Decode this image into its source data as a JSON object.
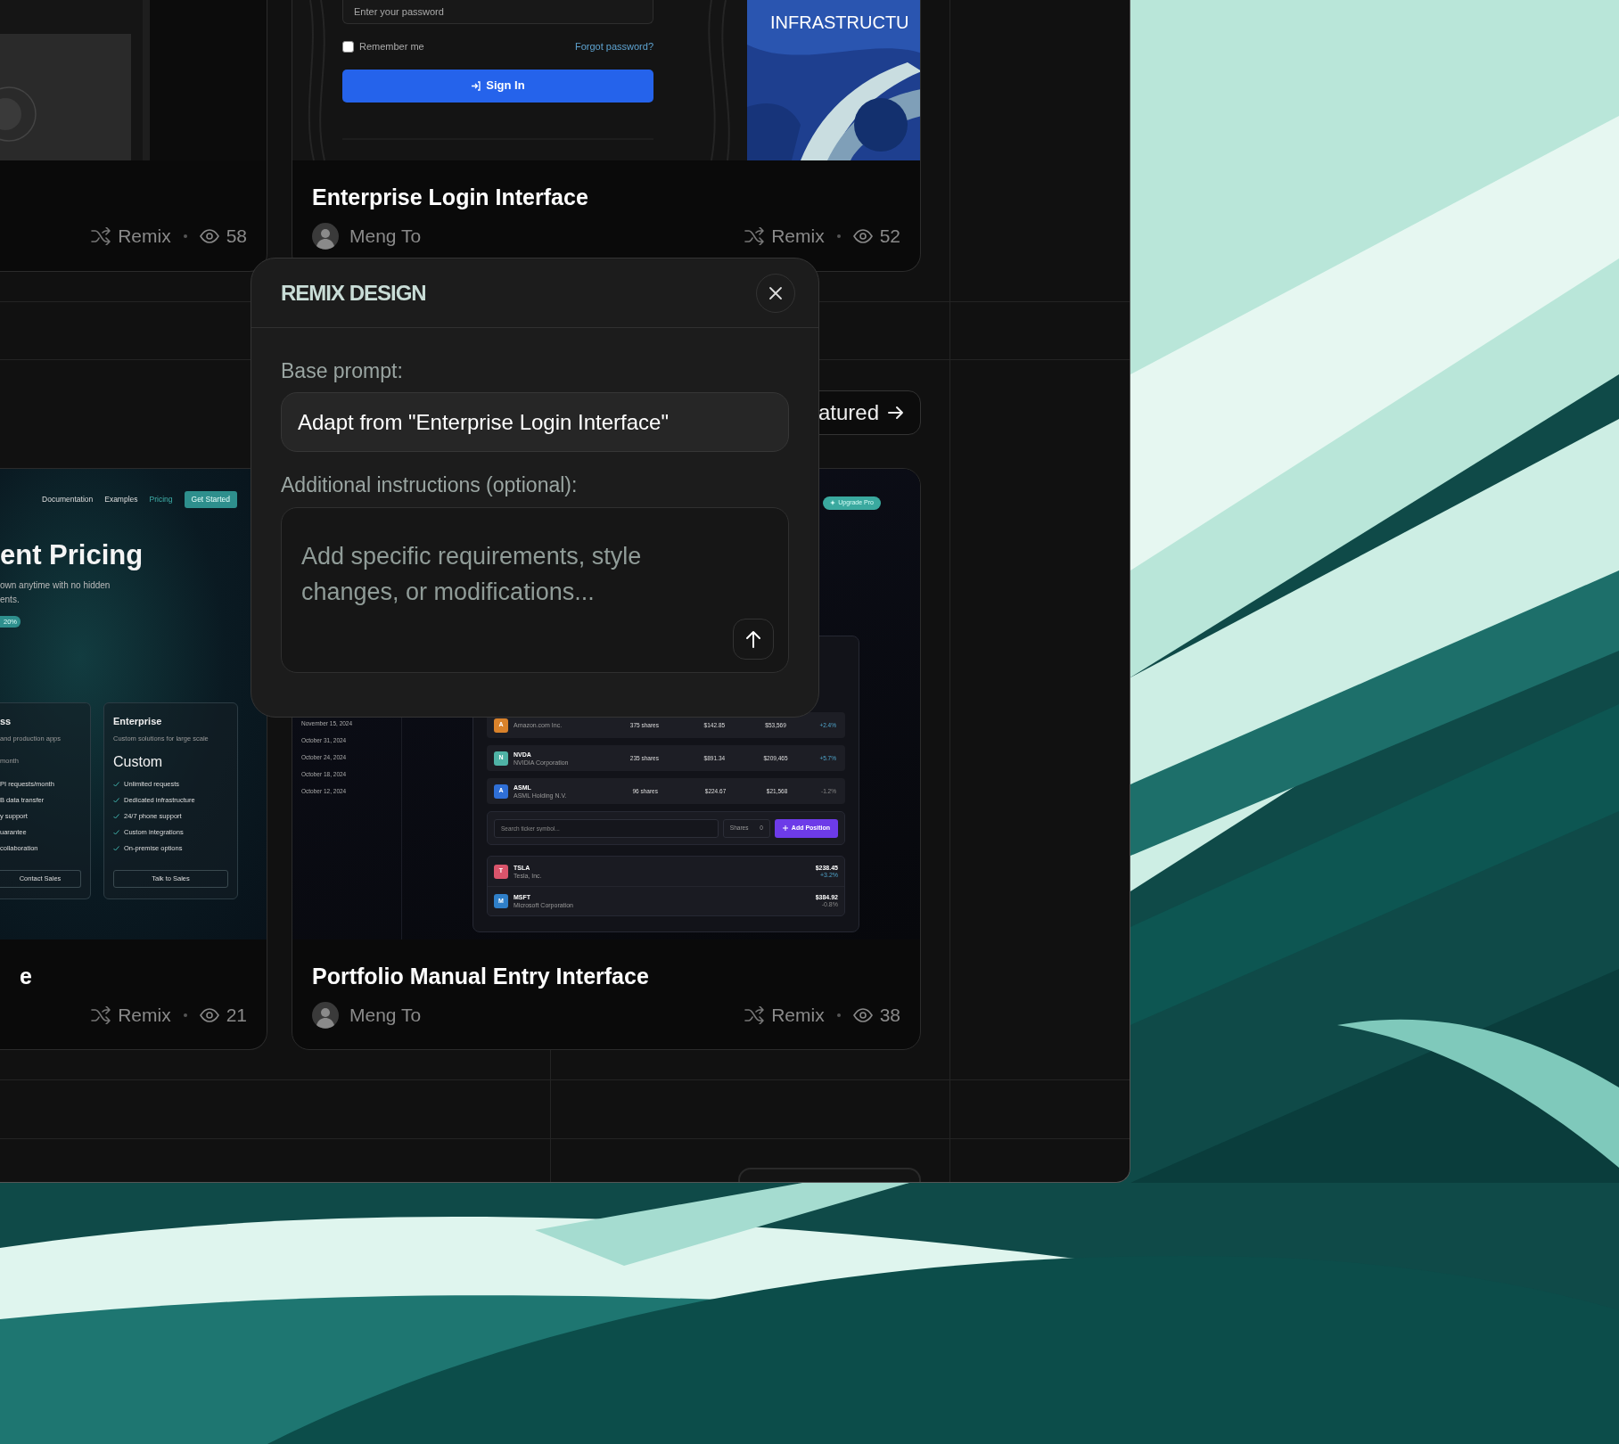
{
  "top_cards": [
    {
      "thumbnail": {
        "kind": "dark-ui"
      },
      "remix_label": "Remix",
      "views": "58"
    },
    {
      "thumbnail": {
        "kind": "login",
        "password_placeholder": "Enter your password",
        "remember_label": "Remember me",
        "remember_checked": false,
        "forgot_link": "Forgot password?",
        "sign_in_label": "Sign In",
        "hero_text": "INFRASTRUCTU"
      },
      "title": "Enterprise Login Interface",
      "author": "Meng To",
      "remix_label": "Remix",
      "views": "52"
    }
  ],
  "featured_button": {
    "label": "atured"
  },
  "bottom_cards": [
    {
      "thumbnail": {
        "kind": "pricing",
        "nav": [
          {
            "label": "Documentation",
            "selected": false
          },
          {
            "label": "Examples",
            "selected": false
          },
          {
            "label": "Pricing",
            "selected": true
          }
        ],
        "cta": "Get Started",
        "heading": "ent Pricing",
        "subtext": [
          "own anytime with no hidden",
          "ents."
        ],
        "badge": "20%",
        "plans": [
          {
            "name": "ss",
            "description": "and production apps",
            "price_note": "month",
            "show_checks": false,
            "features": [
              "PI requests/month",
              "B data transfer",
              "y support",
              "uarantee",
              "collaboration"
            ],
            "button": "Contact Sales"
          },
          {
            "name": "Enterprise",
            "description": "Custom solutions for large scale",
            "price": "Custom",
            "show_checks": true,
            "features": [
              "Unlimited requests",
              "Dedicated infrastructure",
              "24/7 phone support",
              "Custom integrations",
              "On-premise options"
            ],
            "button": "Talk to Sales"
          }
        ]
      },
      "title": "e",
      "remix_label": "Remix",
      "views": "21"
    },
    {
      "thumbnail": {
        "kind": "portfolio",
        "upgrade_badge": "Upgrade Pro",
        "dates": [
          "November 15, 2024",
          "October 31, 2024",
          "October 24, 2024",
          "October 18, 2024",
          "October 12, 2024"
        ],
        "holdings": [
          {
            "letter": "A",
            "color": "#d9822b",
            "name": "Amazon.com Inc.",
            "shares": "375 shares",
            "price": "$142.85",
            "value": "$53,569",
            "change": "+2.4%",
            "rising": true
          },
          {
            "symbol": "NVDA",
            "letter": "N",
            "color": "#4fb3a6",
            "name": "NVIDIA Corporation",
            "shares": "235 shares",
            "price": "$891.34",
            "value": "$209,465",
            "change": "+5.7%",
            "rising": true
          },
          {
            "symbol": "ASML",
            "letter": "A",
            "color": "#2f6fd6",
            "name": "ASML Holding N.V.",
            "shares": "96 shares",
            "price": "$224.67",
            "value": "$21,568",
            "change": "-1.2%",
            "rising": false
          }
        ],
        "search_placeholder": "Search ticker symbol...",
        "shares_label": "Shares",
        "shares_value": "0",
        "add_button": "Add Position",
        "watchlist": [
          {
            "symbol": "TSLA",
            "letter": "T",
            "color": "#d9546b",
            "name": "Tesla, Inc.",
            "price": "$238.45",
            "change": "+3.2%",
            "rising": true
          },
          {
            "symbol": "MSFT",
            "letter": "M",
            "color": "#2f7fc8",
            "name": "Microsoft Corporation",
            "price": "$384.92",
            "change": "-0.8%",
            "rising": false
          }
        ]
      },
      "title": "Portfolio Manual Entry Interface",
      "author": "Meng To",
      "remix_label": "Remix",
      "views": "38"
    }
  ],
  "more_button": {
    "visible": true
  },
  "modal": {
    "title": "REMIX DESIGN",
    "base_label": "Base prompt:",
    "base_value": "Adapt from \"Enterprise Login Interface\"",
    "extra_label": "Additional instructions (optional):",
    "extra_placeholder": "Add specific requirements, style changes, or modifications..."
  }
}
